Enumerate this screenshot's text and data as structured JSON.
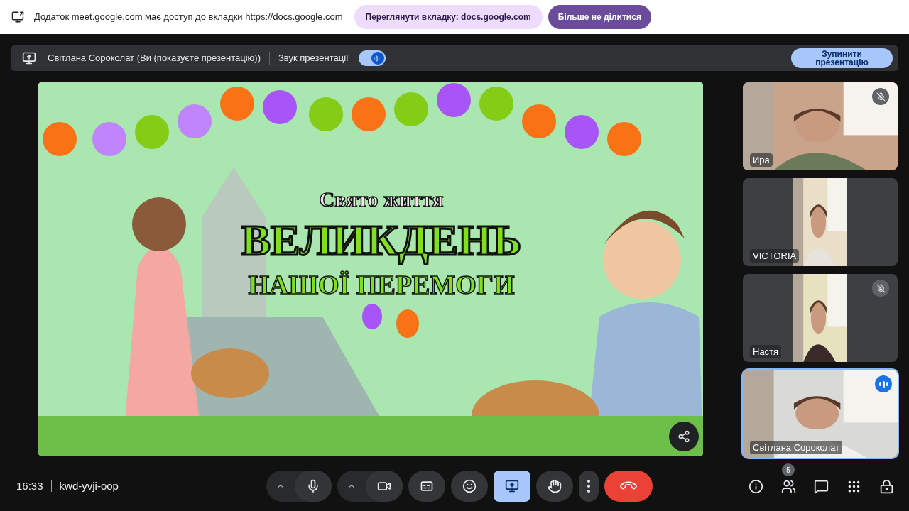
{
  "notification": {
    "text": "Додаток meet.google.com має доступ до вкладки https://docs.google.com",
    "view_button": "Переглянути вкладку: docs.google.com",
    "stop_button": "Більше не ділитися"
  },
  "presenting_bar": {
    "presenter": "Світлана Сороколат (Ви (показуєте презентацію))",
    "audio_label": "Звук презентації",
    "audio_on": true,
    "stop_button": "Зупинити презентацію"
  },
  "slide": {
    "subtitle": "Свято життя",
    "title": "ВЕЛИКДЕНЬ",
    "title_line_2": "НАШОЇ ПЕРЕМОГИ"
  },
  "participants": [
    {
      "name": "Ира",
      "muted": true,
      "speaking": false
    },
    {
      "name": "VICTORIA",
      "muted": false,
      "speaking": false
    },
    {
      "name": "Настя",
      "muted": true,
      "speaking": false
    },
    {
      "name": "Світлана Сороколат",
      "muted": false,
      "speaking": true
    }
  ],
  "meeting": {
    "time": "16:33",
    "code": "kwd-yvji-oop"
  },
  "controls": [
    {
      "kind": "mic",
      "on": true
    },
    {
      "kind": "camera",
      "on": true
    },
    {
      "kind": "captions",
      "on": false
    },
    {
      "kind": "emoji",
      "on": false
    },
    {
      "kind": "present",
      "on": true
    },
    {
      "kind": "hand",
      "on": false
    },
    {
      "kind": "more"
    },
    {
      "kind": "hangup"
    }
  ],
  "side_controls": [
    {
      "kind": "info"
    },
    {
      "kind": "people",
      "badge": "5"
    },
    {
      "kind": "chat"
    },
    {
      "kind": "apps"
    },
    {
      "kind": "lock"
    }
  ]
}
